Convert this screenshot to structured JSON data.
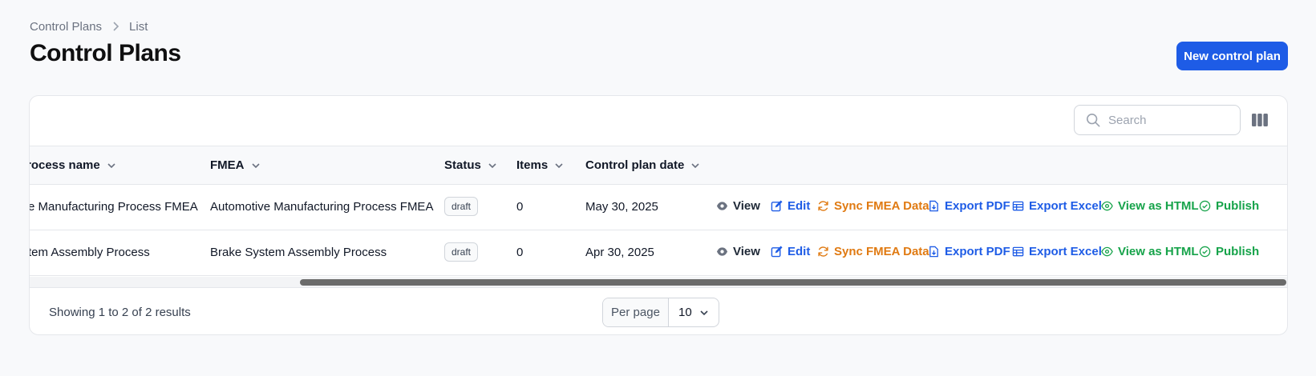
{
  "breadcrumb": {
    "parent": "Control Plans",
    "current": "List"
  },
  "page_title": "Control Plans",
  "new_button": "New control plan",
  "search": {
    "placeholder": "Search"
  },
  "columns": {
    "process_name": "rocess name",
    "fmea": "FMEA",
    "status": "Status",
    "items": "Items",
    "date": "Control plan date"
  },
  "rows": [
    {
      "process_name": "e Manufacturing Process FMEA",
      "fmea": "Automotive Manufacturing Process FMEA",
      "status": "draft",
      "items": "0",
      "date": "May 30, 2025"
    },
    {
      "process_name": "tem Assembly Process",
      "fmea": "Brake System Assembly Process",
      "status": "draft",
      "items": "0",
      "date": "Apr 30, 2025"
    }
  ],
  "actions": {
    "view": "View",
    "edit": "Edit",
    "sync": "Sync FMEA Data",
    "export_pdf": "Export PDF",
    "export_excel": "Export Excel",
    "view_html": "View as HTML",
    "publish": "Publish"
  },
  "footer": {
    "results": "Showing 1 to 2 of 2 results",
    "per_page_label": "Per page",
    "per_page_value": "10"
  },
  "colors": {
    "primary": "#1e5ce6",
    "sync": "#e07a12",
    "html_publish": "#16a34a",
    "view": "#1f2937"
  }
}
